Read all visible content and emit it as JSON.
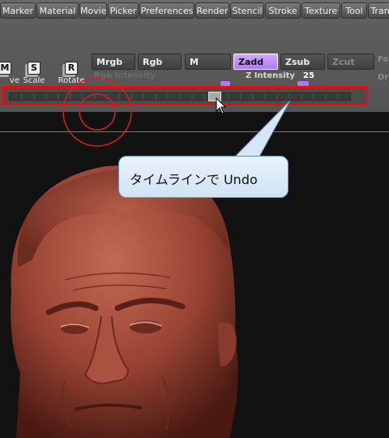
{
  "menubar": {
    "items": [
      "Marker",
      "Material",
      "Movie",
      "Picker",
      "Preferences",
      "Render",
      "Stencil",
      "Stroke",
      "Texture",
      "Tool",
      "Tran"
    ]
  },
  "transform": {
    "move_label": "ve",
    "scale_label": "Scale",
    "rotate_label": "Rotate",
    "move_glyph": "M",
    "scale_glyph": "S",
    "rotate_glyph": "R"
  },
  "modes": {
    "mrgb": "Mrgb",
    "rgb": "Rgb",
    "m": "M",
    "zadd": "Zadd",
    "zsub": "Zsub",
    "zcut": "Zcut"
  },
  "sliders": {
    "rgb_intensity_label": "Rgb Intensity",
    "z_intensity_label": "Z Intensity",
    "z_intensity_value": "25"
  },
  "side_labels": {
    "top": "Fo",
    "bottom": "Dr"
  },
  "timeline": {
    "knob_position": 0.6
  },
  "callout": {
    "text": "タイムラインで Undo"
  },
  "colors": {
    "highlight_border": "#e01010",
    "active_mode": "#c08ff8",
    "callout_bg": "#dde9f6"
  }
}
